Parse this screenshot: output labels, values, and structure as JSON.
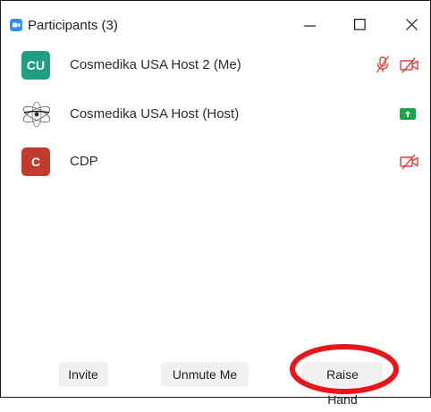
{
  "window": {
    "title": "Participants (3)",
    "app_icon": "zoom-camera-icon",
    "controls": [
      "minimize-icon",
      "maximize-icon",
      "close-icon"
    ]
  },
  "participants": [
    {
      "name": "Cosmedika USA Host 2 (Me)",
      "avatar_initials": "CU",
      "avatar_color": "#1f9e82",
      "status_icons": [
        "muted-microphone-icon",
        "video-off-icon"
      ]
    },
    {
      "name": "Cosmedika USA Host (Host)",
      "avatar_initials": "",
      "avatar_image": "logo-image-avatar",
      "status_icons": [
        "screen-share-icon"
      ]
    },
    {
      "name": "CDP",
      "avatar_initials": "C",
      "avatar_color": "#c23b2e",
      "status_icons": [
        "video-off-icon"
      ]
    }
  ],
  "footer": {
    "invite_label": "Invite",
    "unmute_label": "Unmute Me",
    "raise_hand_label": "Raise Hand"
  },
  "colors": {
    "muted_red": "#e0403a",
    "share_green": "#1aa548",
    "zoom_blue": "#2d8cff",
    "highlight_ring": "#e8151b"
  }
}
